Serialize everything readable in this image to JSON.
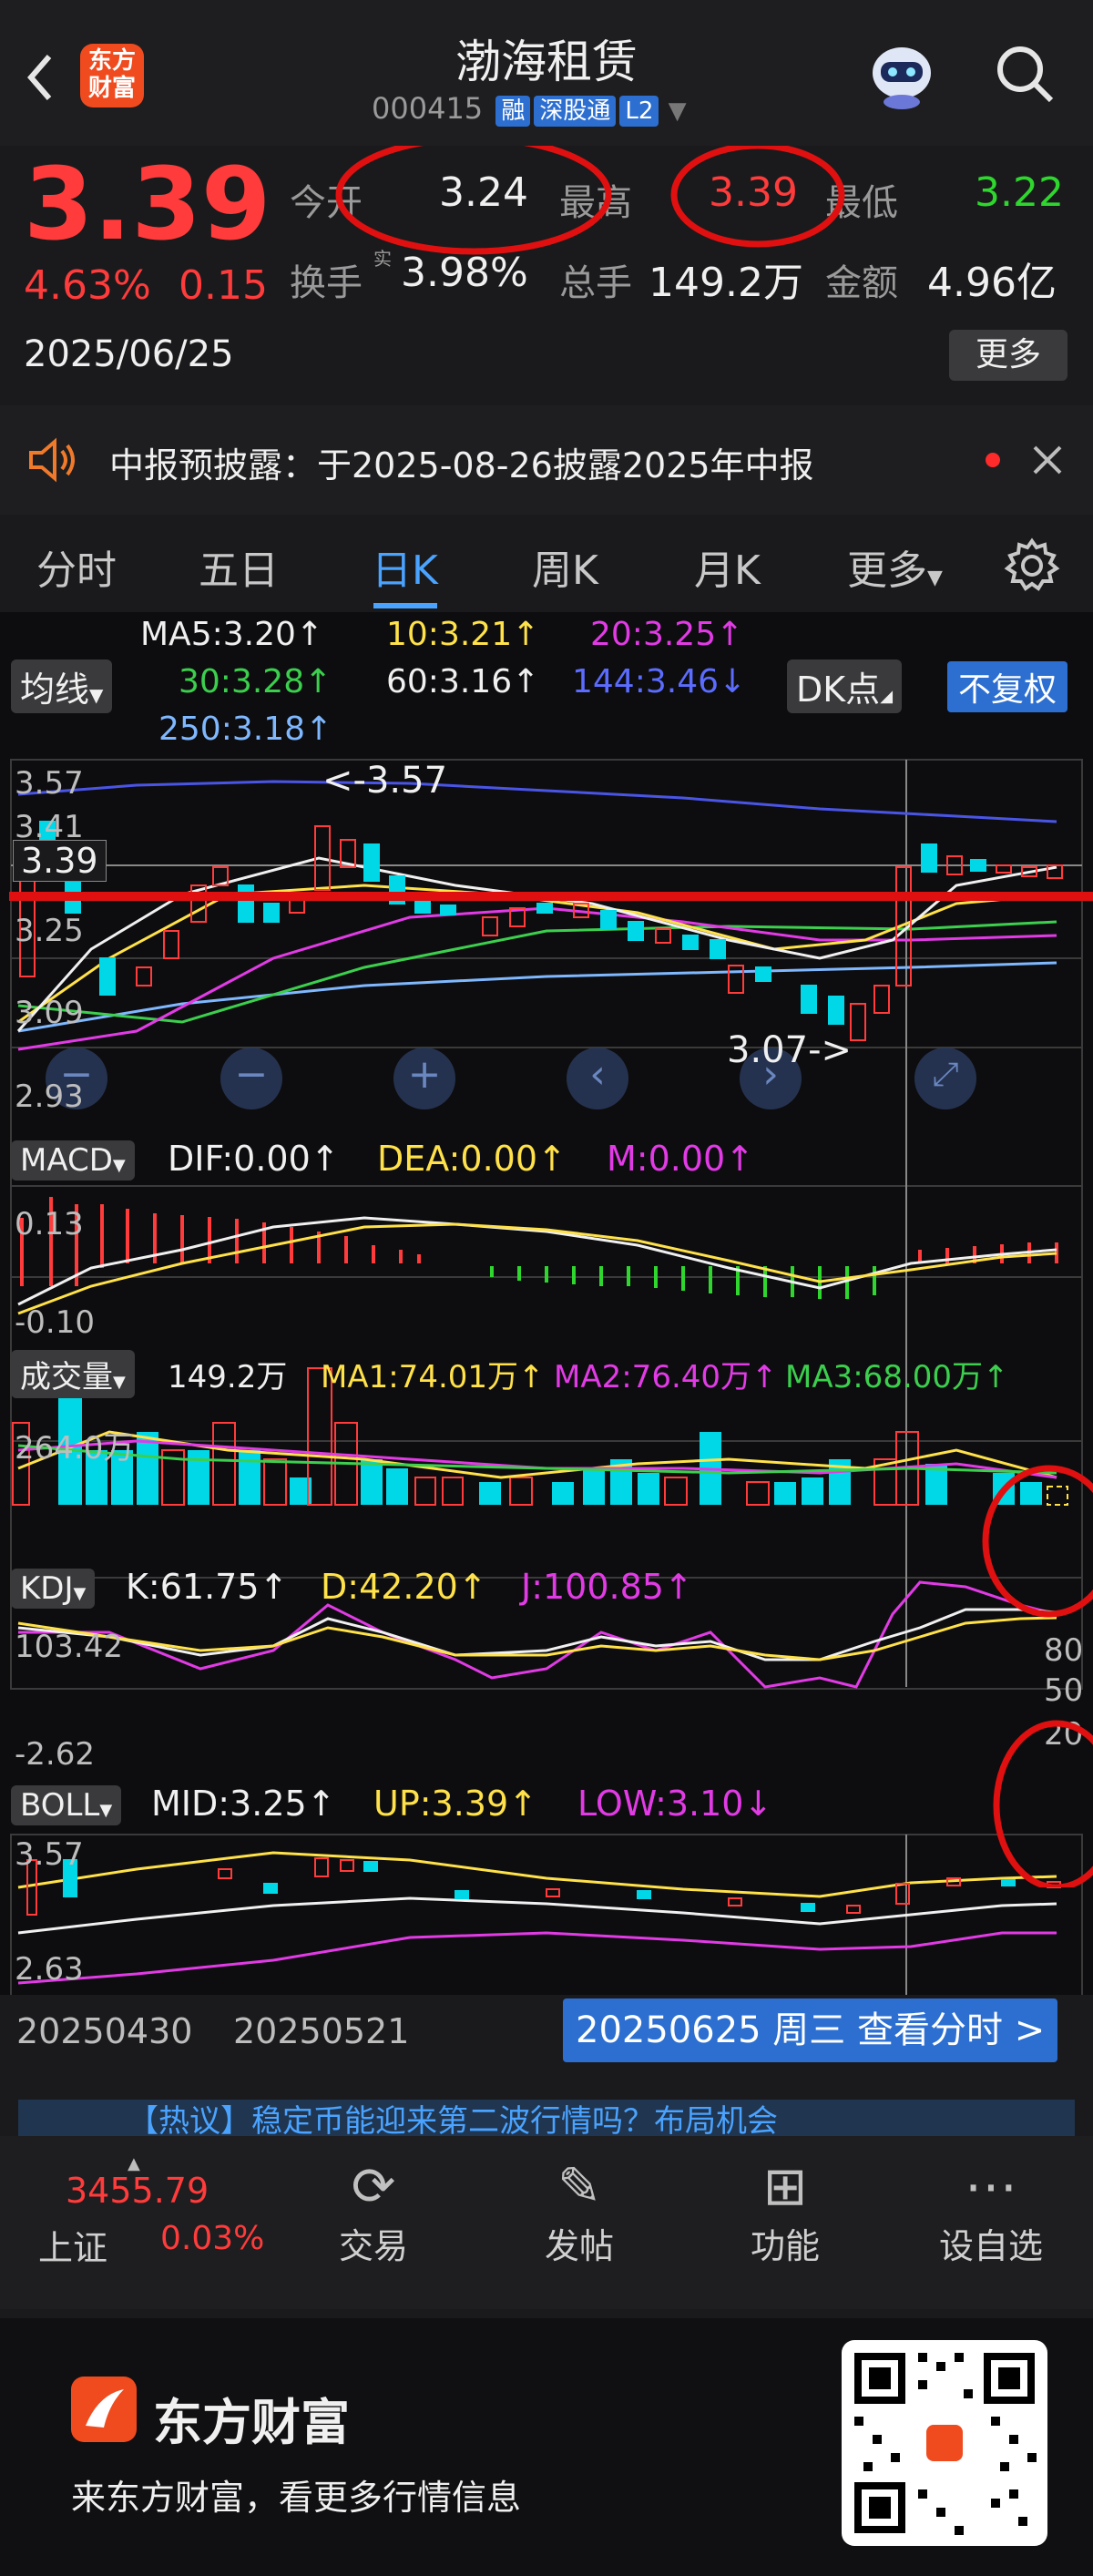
{
  "header": {
    "back_icon": "back-arrow-icon",
    "logo_text_top": "东方",
    "logo_text_bottom": "财富",
    "title": "渤海租赁",
    "code": "000415",
    "tags": [
      "融",
      "深股通",
      "L2"
    ],
    "assistant_icon": "robot-assistant-icon",
    "search_icon": "search-icon"
  },
  "quote": {
    "price": "3.39",
    "change_pct": "4.63%",
    "change_amt": "0.15",
    "date": "2025/06/25",
    "open_label": "今开",
    "open": "3.24",
    "high_label": "最高",
    "high": "3.39",
    "low_label": "最低",
    "low": "3.22",
    "turnover_label": "换手",
    "turnover_sup": "实",
    "turnover": "3.98%",
    "volume_label": "总手",
    "volume": "149.2万",
    "amount_label": "金额",
    "amount": "4.96亿",
    "more_button": "更多"
  },
  "notice": {
    "icon": "speaker-icon",
    "text": "中报预披露：于2025-08-26披露2025年中报"
  },
  "tabs": [
    "分时",
    "五日",
    "日K",
    "周K",
    "月K",
    "更多"
  ],
  "active_tab": "日K",
  "kline": {
    "ma_selector": "均线",
    "ma5": "MA5:3.20↑",
    "ma10": "10:3.21↑",
    "ma20": "20:3.25↑",
    "ma30": "30:3.28↑",
    "ma60": "60:3.16↑",
    "ma144": "144:3.46↓",
    "ma250": "250:3.18↑",
    "dk_button": "DK点",
    "adjust_button": "不复权",
    "y_top": "3.57",
    "y_q1": "3.41",
    "y_mid": "3.25",
    "y_q3": "3.09",
    "y_bottom": "2.93",
    "price_marker": "3.39",
    "max_label": "<-3.57",
    "min_label": "3.07->"
  },
  "macd": {
    "selector": "MACD",
    "dif": "DIF:0.00↑",
    "dea": "DEA:0.00↑",
    "m": "M:0.00↑",
    "y_top": "0.13",
    "y_bottom": "-0.10"
  },
  "volume": {
    "selector": "成交量",
    "value": "149.2万",
    "ma1": "MA1:74.01万↑",
    "ma2": "MA2:76.40万↑",
    "ma3": "MA3:68.00万↑",
    "y_top": "264.0万"
  },
  "kdj": {
    "selector": "KDJ",
    "k": "K:61.75↑",
    "d": "D:42.20↑",
    "j": "J:100.85↑",
    "y_top": "103.42",
    "y_bottom": "-2.62",
    "r80": "80",
    "r50": "50",
    "r20": "20"
  },
  "boll": {
    "selector": "BOLL",
    "mid": "MID:3.25↑",
    "up": "UP:3.39↑",
    "low": "LOW:3.10↓",
    "y_top": "3.57",
    "y_bottom": "2.63"
  },
  "dates": {
    "d1": "20250430",
    "d2": "20250521",
    "current": "20250625 周三 查看分时 >"
  },
  "banner": {
    "text": "【热议】稳定币能迎来第二波行情吗？布局机会"
  },
  "bottom_nav": {
    "index_value": "3455.79",
    "index_name": "上证",
    "index_change": "0.03%",
    "items": [
      {
        "label": "交易",
        "icon": "yen-cycle-icon"
      },
      {
        "label": "发帖",
        "icon": "edit-icon"
      },
      {
        "label": "功能",
        "icon": "grid-icon"
      },
      {
        "label": "设自选",
        "icon": "more-dots-icon"
      }
    ]
  },
  "footer": {
    "brand": "东方财富",
    "slogan": "来东方财富，看更多行情信息"
  },
  "colors": {
    "up": "#ff3b3b",
    "down": "#2ed62e",
    "accent": "#4aa3ff",
    "annotation": "#e01010"
  }
}
